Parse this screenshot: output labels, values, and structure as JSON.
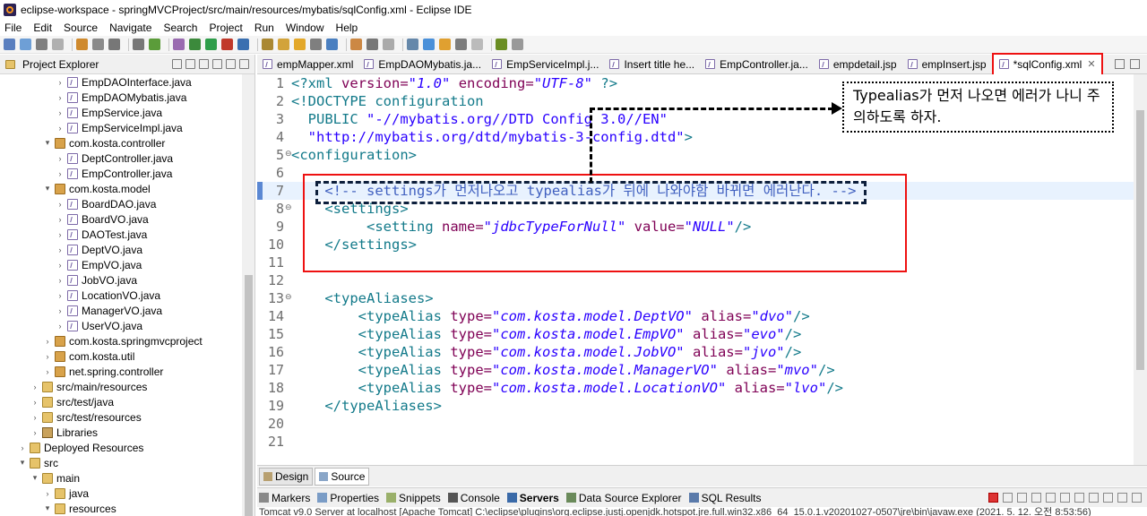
{
  "window": {
    "title": "eclipse-workspace - springMVCProject/src/main/resources/mybatis/sqlConfig.xml - Eclipse IDE"
  },
  "menu": [
    "File",
    "Edit",
    "Source",
    "Navigate",
    "Search",
    "Project",
    "Run",
    "Window",
    "Help"
  ],
  "explorer": {
    "title": "Project Explorer",
    "items": [
      {
        "label": "EmpDAOInterface.java",
        "type": "java",
        "indent": 5,
        "twisty": ">"
      },
      {
        "label": "EmpDAOMybatis.java",
        "type": "java",
        "indent": 5,
        "twisty": ">"
      },
      {
        "label": "EmpService.java",
        "type": "java",
        "indent": 5,
        "twisty": ">"
      },
      {
        "label": "EmpServiceImpl.java",
        "type": "java",
        "indent": 5,
        "twisty": ">"
      },
      {
        "label": "com.kosta.controller",
        "type": "pkg",
        "indent": 4,
        "twisty": "v"
      },
      {
        "label": "DeptController.java",
        "type": "java",
        "indent": 5,
        "twisty": ">"
      },
      {
        "label": "EmpController.java",
        "type": "java",
        "indent": 5,
        "twisty": ">"
      },
      {
        "label": "com.kosta.model",
        "type": "pkg",
        "indent": 4,
        "twisty": "v"
      },
      {
        "label": "BoardDAO.java",
        "type": "java",
        "indent": 5,
        "twisty": ">"
      },
      {
        "label": "BoardVO.java",
        "type": "java",
        "indent": 5,
        "twisty": ">"
      },
      {
        "label": "DAOTest.java",
        "type": "java",
        "indent": 5,
        "twisty": ">"
      },
      {
        "label": "DeptVO.java",
        "type": "java",
        "indent": 5,
        "twisty": ">"
      },
      {
        "label": "EmpVO.java",
        "type": "java",
        "indent": 5,
        "twisty": ">"
      },
      {
        "label": "JobVO.java",
        "type": "java",
        "indent": 5,
        "twisty": ">"
      },
      {
        "label": "LocationVO.java",
        "type": "java",
        "indent": 5,
        "twisty": ">"
      },
      {
        "label": "ManagerVO.java",
        "type": "java",
        "indent": 5,
        "twisty": ">"
      },
      {
        "label": "UserVO.java",
        "type": "java",
        "indent": 5,
        "twisty": ">"
      },
      {
        "label": "com.kosta.springmvcproject",
        "type": "pkg",
        "indent": 4,
        "twisty": ">"
      },
      {
        "label": "com.kosta.util",
        "type": "pkg",
        "indent": 4,
        "twisty": ">"
      },
      {
        "label": "net.spring.controller",
        "type": "pkg",
        "indent": 4,
        "twisty": ">"
      },
      {
        "label": "src/main/resources",
        "type": "folder",
        "indent": 3,
        "twisty": ">"
      },
      {
        "label": "src/test/java",
        "type": "folder",
        "indent": 3,
        "twisty": ">"
      },
      {
        "label": "src/test/resources",
        "type": "folder",
        "indent": 3,
        "twisty": ">"
      },
      {
        "label": "Libraries",
        "type": "lib",
        "indent": 3,
        "twisty": ">"
      },
      {
        "label": "Deployed Resources",
        "type": "folder",
        "indent": 2,
        "twisty": ">"
      },
      {
        "label": "src",
        "type": "folder",
        "indent": 2,
        "twisty": "v"
      },
      {
        "label": "main",
        "type": "folder",
        "indent": 3,
        "twisty": "v"
      },
      {
        "label": "java",
        "type": "folder",
        "indent": 4,
        "twisty": ">"
      },
      {
        "label": "resources",
        "type": "folder",
        "indent": 4,
        "twisty": "v"
      }
    ]
  },
  "editor_tabs": [
    {
      "label": "empMapper.xml",
      "active": false
    },
    {
      "label": "EmpDAOMybatis.ja...",
      "active": false
    },
    {
      "label": "EmpServiceImpl.j...",
      "active": false
    },
    {
      "label": "Insert title he...",
      "active": false
    },
    {
      "label": "EmpController.ja...",
      "active": false
    },
    {
      "label": "empdetail.jsp",
      "active": false
    },
    {
      "label": "empInsert.jsp",
      "active": false
    },
    {
      "label": "*sqlConfig.xml",
      "active": true
    }
  ],
  "code_lines": [
    {
      "n": "1",
      "fold": "",
      "html": "<span class=\"t-tag\">&lt;?xml</span> <span class=\"t-attr\">version=</span><span class=\"t-str\">\"1.0\"</span> <span class=\"t-attr\">encoding=</span><span class=\"t-str\">\"UTF-8\"</span> <span class=\"t-tag\">?&gt;</span>"
    },
    {
      "n": "2",
      "fold": "",
      "html": "<span class=\"t-tag\">&lt;!DOCTYPE configuration</span>"
    },
    {
      "n": "3",
      "fold": "",
      "html": "  <span class=\"t-dtd\">PUBLIC</span> <span class=\"t-str\" style=\"font-style:normal\">\"-//mybatis.org//DTD Config 3.0//EN\"</span>"
    },
    {
      "n": "4",
      "fold": "",
      "html": "  <span class=\"t-str\" style=\"font-style:normal\">\"http://mybatis.org/dtd/mybatis-3-config.dtd\"</span><span class=\"t-tag\">&gt;</span>"
    },
    {
      "n": "5",
      "fold": "⊖",
      "html": "<span class=\"t-tag\">&lt;configuration&gt;</span>"
    },
    {
      "n": "6",
      "fold": "",
      "html": ""
    },
    {
      "n": "7",
      "fold": "",
      "html": "    <span class=\"t-com\">&lt;!-- settings가 먼저나오고 typealias가 뒤에 나와야함 바뀌면 에러난다. --&gt;</span>"
    },
    {
      "n": "8",
      "fold": "⊖",
      "html": "    <span class=\"t-tag\">&lt;settings&gt;</span>"
    },
    {
      "n": "9",
      "fold": "",
      "html": "         <span class=\"t-tag\">&lt;setting</span> <span class=\"t-attr\">name=</span><span class=\"t-str\">\"jdbcTypeForNull\"</span> <span class=\"t-attr\">value=</span><span class=\"t-str\">\"NULL\"</span><span class=\"t-tag\">/&gt;</span>"
    },
    {
      "n": "10",
      "fold": "",
      "html": "    <span class=\"t-tag\">&lt;/settings&gt;</span>"
    },
    {
      "n": "11",
      "fold": "",
      "html": ""
    },
    {
      "n": "12",
      "fold": "",
      "html": ""
    },
    {
      "n": "13",
      "fold": "⊖",
      "html": "    <span class=\"t-tag\">&lt;typeAliases&gt;</span>"
    },
    {
      "n": "14",
      "fold": "",
      "html": "        <span class=\"t-tag\">&lt;typeAlias</span> <span class=\"t-attr\">type=</span><span class=\"t-str\">\"com.kosta.model.DeptVO\"</span> <span class=\"t-attr\">alias=</span><span class=\"t-str\">\"dvo\"</span><span class=\"t-tag\">/&gt;</span>"
    },
    {
      "n": "15",
      "fold": "",
      "html": "        <span class=\"t-tag\">&lt;typeAlias</span> <span class=\"t-attr\">type=</span><span class=\"t-str\">\"com.kosta.model.EmpVO\"</span> <span class=\"t-attr\">alias=</span><span class=\"t-str\">\"evo\"</span><span class=\"t-tag\">/&gt;</span>"
    },
    {
      "n": "16",
      "fold": "",
      "html": "        <span class=\"t-tag\">&lt;typeAlias</span> <span class=\"t-attr\">type=</span><span class=\"t-str\">\"com.kosta.model.JobVO\"</span> <span class=\"t-attr\">alias=</span><span class=\"t-str\">\"jvo\"</span><span class=\"t-tag\">/&gt;</span>"
    },
    {
      "n": "17",
      "fold": "",
      "html": "        <span class=\"t-tag\">&lt;typeAlias</span> <span class=\"t-attr\">type=</span><span class=\"t-str\">\"com.kosta.model.ManagerVO\"</span> <span class=\"t-attr\">alias=</span><span class=\"t-str\">\"mvo\"</span><span class=\"t-tag\">/&gt;</span>"
    },
    {
      "n": "18",
      "fold": "",
      "html": "        <span class=\"t-tag\">&lt;typeAlias</span> <span class=\"t-attr\">type=</span><span class=\"t-str\">\"com.kosta.model.LocationVO\"</span> <span class=\"t-attr\">alias=</span><span class=\"t-str\">\"lvo\"</span><span class=\"t-tag\">/&gt;</span>"
    },
    {
      "n": "19",
      "fold": "",
      "html": "    <span class=\"t-tag\">&lt;/typeAliases&gt;</span>"
    },
    {
      "n": "20",
      "fold": "",
      "html": ""
    },
    {
      "n": "21",
      "fold": "",
      "html": ""
    }
  ],
  "annotation": {
    "note": "Typealias가 먼저 나오면 에러가 나니 주의하도록 하자."
  },
  "design_tabs": [
    {
      "label": "Design",
      "active": false
    },
    {
      "label": "Source",
      "active": true
    }
  ],
  "views": [
    {
      "label": "Markers",
      "bold": false
    },
    {
      "label": "Properties",
      "bold": false
    },
    {
      "label": "Snippets",
      "bold": false
    },
    {
      "label": "Console",
      "bold": false
    },
    {
      "label": "Servers",
      "bold": true
    },
    {
      "label": "Data Source Explorer",
      "bold": false
    },
    {
      "label": "SQL Results",
      "bold": false
    }
  ],
  "console_status": "Tomcat v9.0 Server at localhost [Apache Tomcat] C:\\eclipse\\plugins\\org.eclipse.justj.openjdk.hotspot.jre.full.win32.x86_64_15.0.1.v20201027-0507\\jre\\bin\\javaw.exe  (2021. 5. 12. 오전 8:53:56)",
  "colors": {
    "tag": "#137a8a",
    "attr": "#7f0055",
    "string": "#2a00ff",
    "comment": "#3f5fbf",
    "highlight_box": "#e11111"
  }
}
